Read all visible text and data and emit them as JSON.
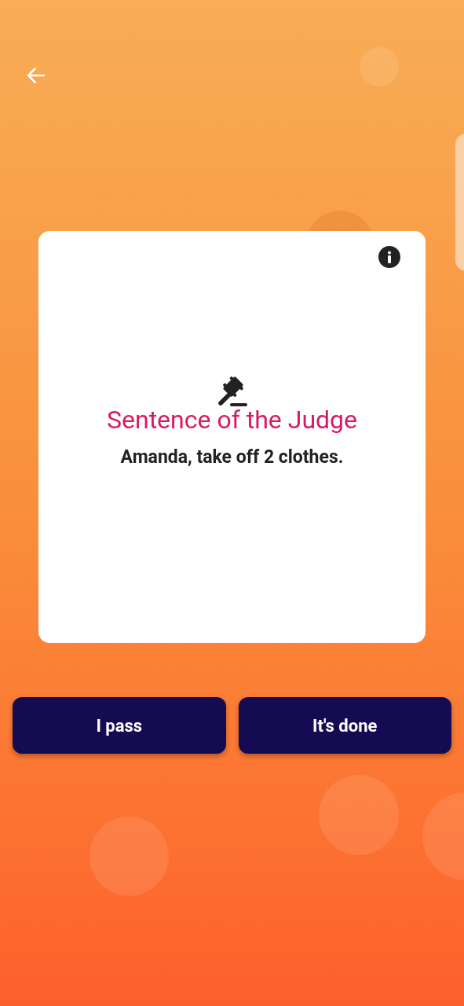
{
  "card": {
    "title": "Sentence of the Judge",
    "message": "Amanda, take off 2 clothes."
  },
  "buttons": [
    {
      "label": "I pass"
    },
    {
      "label": "It's done"
    }
  ]
}
